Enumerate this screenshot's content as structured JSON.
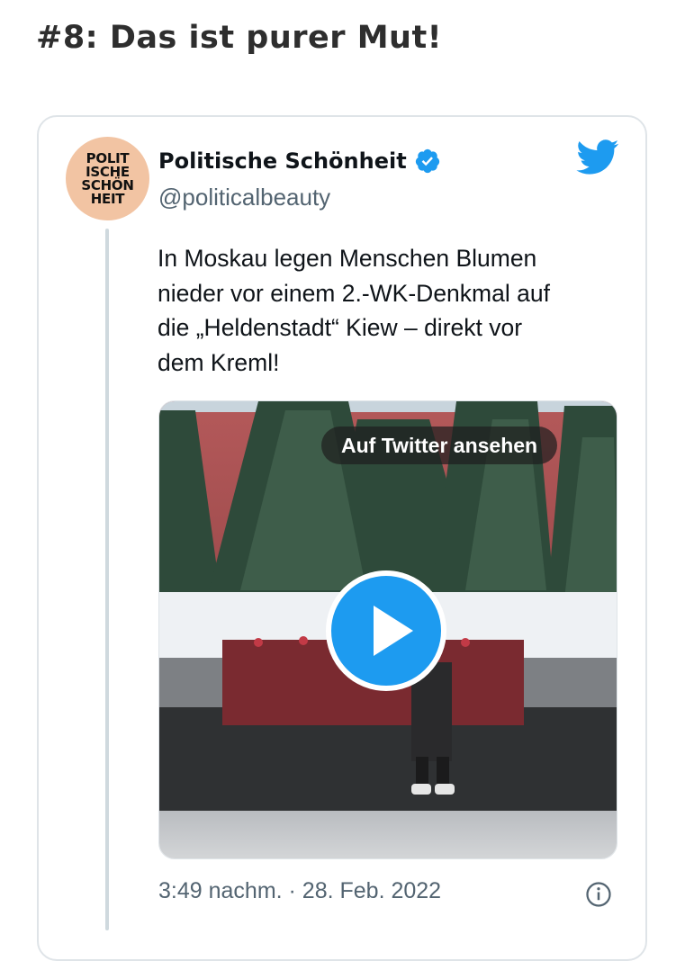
{
  "article": {
    "heading": "#8: Das ist purer Mut!"
  },
  "tweet": {
    "avatar_text": "POLIT\nISCHE\nSCHÖN\nHEIT",
    "display_name": "Politische Schönheit",
    "verified": true,
    "handle": "@politicalbeauty",
    "text": "In Moskau legen Menschen Blumen\nnieder vor einem 2.-WK-Denkmal auf\ndie „Heldenstadt“ Kiew – direkt vor\ndem Kreml!",
    "media": {
      "watch_label": "Auf Twitter ansehen",
      "play_icon": "play-icon"
    },
    "timestamp": "3:49 nachm. · 28. Feb. 2022"
  },
  "icons": {
    "brand": "twitter-bird-icon",
    "verified": "verified-badge-icon",
    "info": "info-icon"
  },
  "colors": {
    "twitter_blue": "#1d9bf0",
    "heading": "#2e2e2e",
    "muted_text": "#536471",
    "border": "#dfe4e8",
    "avatar_bg": "#f2c4a3"
  }
}
